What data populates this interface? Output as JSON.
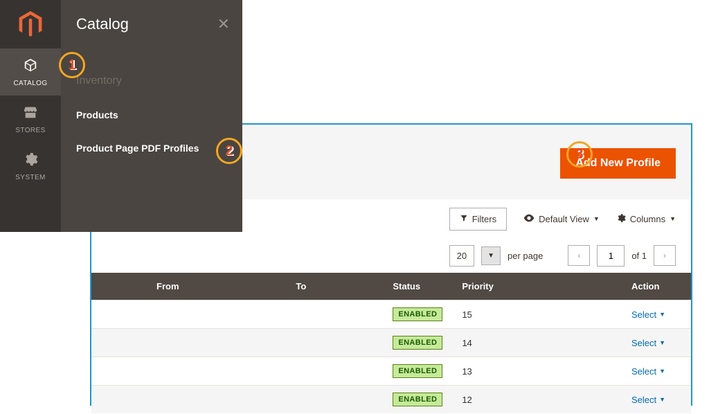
{
  "rail": {
    "items": [
      {
        "label": "CATALOG",
        "icon": "📦",
        "active": true
      },
      {
        "label": "STORES",
        "icon": "🏬",
        "active": false
      },
      {
        "label": "SYSTEM",
        "icon": "⚙",
        "active": false
      }
    ]
  },
  "flyout": {
    "title": "Catalog",
    "close": "✕",
    "section": "Inventory",
    "links": [
      {
        "label": "Products"
      },
      {
        "label": "Product Page PDF Profiles"
      }
    ]
  },
  "toolbar": {
    "add_label": "Add New Profile",
    "filters_label": "Filters",
    "default_view_label": "Default View",
    "columns_label": "Columns",
    "per_page_label": "per page",
    "page_size": "20",
    "page_current": "1",
    "page_total": "of 1",
    "prev": "‹",
    "next": "›"
  },
  "grid": {
    "headers": {
      "blank": "",
      "from": "From",
      "to": "To",
      "status": "Status",
      "priority": "Priority",
      "action": "Action"
    },
    "rows": [
      {
        "status": "ENABLED",
        "priority": "15",
        "action": "Select"
      },
      {
        "status": "ENABLED",
        "priority": "14",
        "action": "Select"
      },
      {
        "status": "ENABLED",
        "priority": "13",
        "action": "Select"
      },
      {
        "status": "ENABLED",
        "priority": "12",
        "action": "Select"
      }
    ]
  },
  "callouts": {
    "n1": "1",
    "n2": "2",
    "n3": "3"
  }
}
